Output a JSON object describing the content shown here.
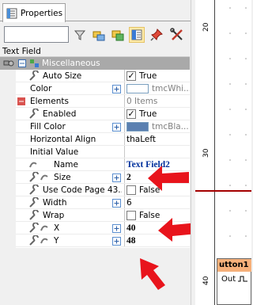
{
  "panel": {
    "tab_label": "Properties",
    "search_placeholder": "",
    "object_name": "Text Field"
  },
  "grid": {
    "category_label": "Miscellaneous",
    "rows": [
      {
        "name": "Auto Size",
        "value": "True"
      },
      {
        "name": "Color",
        "value": "tmcWhi..."
      },
      {
        "name": "Elements",
        "value": "0 Items"
      },
      {
        "name": "Enabled",
        "value": "True"
      },
      {
        "name": "Fill Color",
        "value": "tmcBla..."
      },
      {
        "name": "Horizontal Align",
        "value": "thaLeft"
      },
      {
        "name": "Initial Value",
        "value": ""
      },
      {
        "name": "Name",
        "value": "Text Field2"
      },
      {
        "name": "Size",
        "value": "2"
      },
      {
        "name": "Use Code Page 43...",
        "value": "False"
      },
      {
        "name": "Width",
        "value": "6"
      },
      {
        "name": "Wrap",
        "value": "False"
      },
      {
        "name": "X",
        "value": "40"
      },
      {
        "name": "Y",
        "value": "48"
      }
    ]
  },
  "canvas": {
    "ruler_labels": [
      "20",
      "30",
      "40"
    ],
    "component_title": "utton1",
    "component_port": "Out"
  },
  "colors": {
    "category_bg": "#a9a9a9",
    "annotation_red": "#e8141c",
    "highlight_red": "#a40000",
    "component_header": "#f6b07a"
  }
}
